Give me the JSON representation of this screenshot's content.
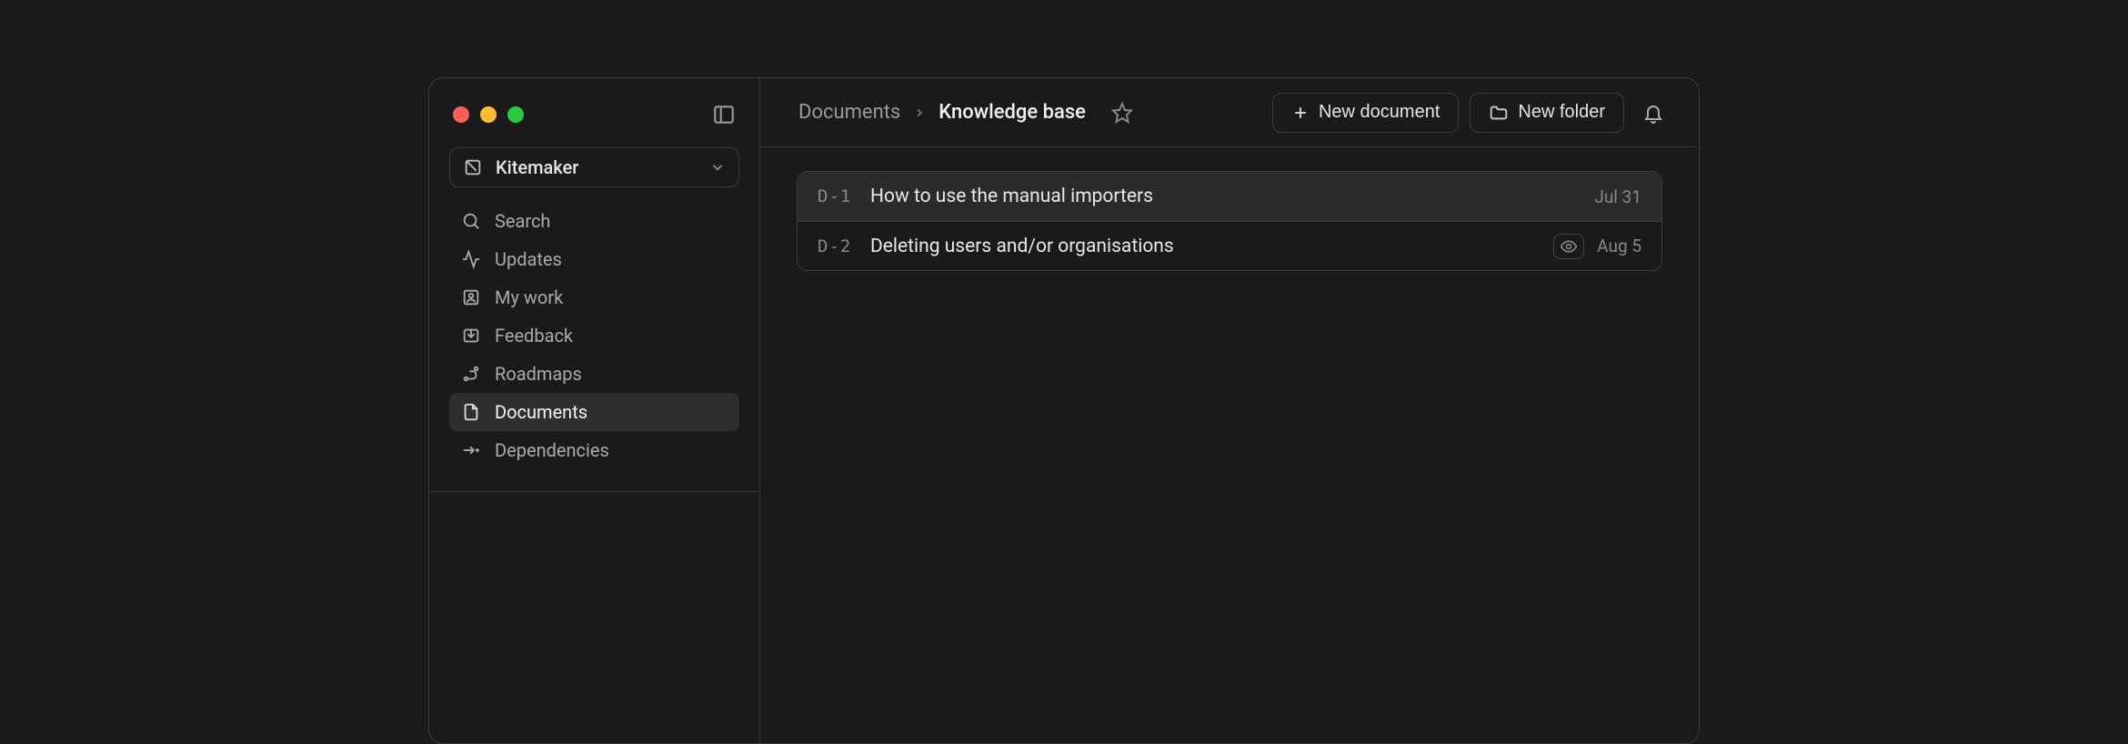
{
  "workspace": {
    "name": "Kitemaker"
  },
  "sidebar": {
    "items": [
      {
        "label": "Search"
      },
      {
        "label": "Updates"
      },
      {
        "label": "My work"
      },
      {
        "label": "Feedback"
      },
      {
        "label": "Roadmaps"
      },
      {
        "label": "Documents"
      },
      {
        "label": "Dependencies"
      }
    ]
  },
  "breadcrumb": {
    "root": "Documents",
    "current": "Knowledge base"
  },
  "actions": {
    "new_document": "New document",
    "new_folder": "New folder"
  },
  "documents": [
    {
      "id": "D-1",
      "title": "How to use the manual importers",
      "date": "Jul 31",
      "watched": false,
      "selected": true
    },
    {
      "id": "D-2",
      "title": "Deleting users and/or organisations",
      "date": "Aug 5",
      "watched": true,
      "selected": false
    }
  ]
}
